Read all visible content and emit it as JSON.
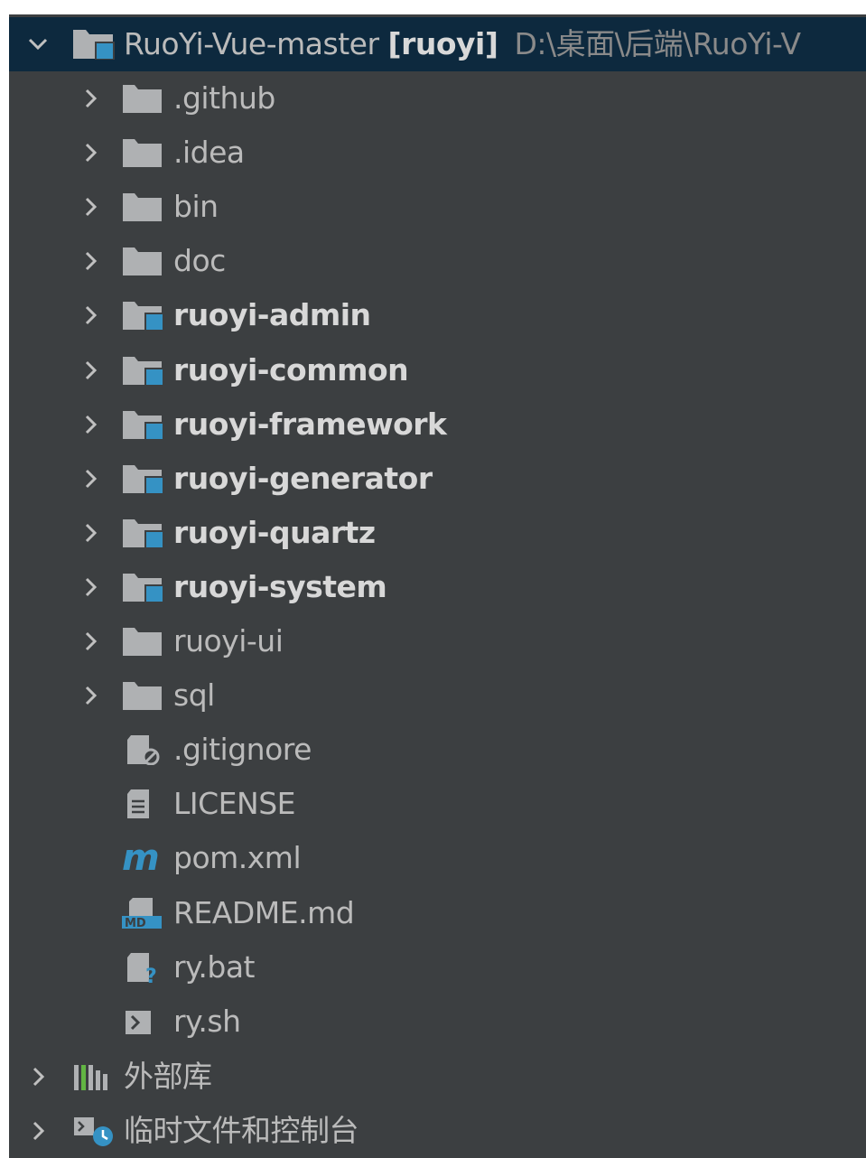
{
  "project": {
    "name": "RuoYi-Vue-master",
    "module": "[ruoyi]",
    "path": "D:\\桌面\\后端\\RuoYi-V"
  },
  "items": [
    {
      "label": ".github",
      "kind": "folder",
      "icon": "folder-icon"
    },
    {
      "label": ".idea",
      "kind": "folder",
      "icon": "folder-icon"
    },
    {
      "label": "bin",
      "kind": "folder",
      "icon": "folder-icon"
    },
    {
      "label": "doc",
      "kind": "folder",
      "icon": "folder-icon"
    },
    {
      "label": "ruoyi-admin",
      "kind": "module",
      "icon": "module-folder-icon"
    },
    {
      "label": "ruoyi-common",
      "kind": "module",
      "icon": "module-folder-icon"
    },
    {
      "label": "ruoyi-framework",
      "kind": "module",
      "icon": "module-folder-icon"
    },
    {
      "label": "ruoyi-generator",
      "kind": "module",
      "icon": "module-folder-icon"
    },
    {
      "label": "ruoyi-quartz",
      "kind": "module",
      "icon": "module-folder-icon"
    },
    {
      "label": "ruoyi-system",
      "kind": "module",
      "icon": "module-folder-icon"
    },
    {
      "label": "ruoyi-ui",
      "kind": "folder",
      "icon": "folder-icon"
    },
    {
      "label": "sql",
      "kind": "folder",
      "icon": "folder-icon"
    },
    {
      "label": ".gitignore",
      "kind": "file",
      "icon": "ignored-file-icon"
    },
    {
      "label": "LICENSE",
      "kind": "file",
      "icon": "text-file-icon"
    },
    {
      "label": "pom.xml",
      "kind": "file",
      "icon": "maven-icon"
    },
    {
      "label": "README.md",
      "kind": "file",
      "icon": "markdown-file-icon"
    },
    {
      "label": "ry.bat",
      "kind": "file",
      "icon": "unknown-file-icon"
    },
    {
      "label": "ry.sh",
      "kind": "file",
      "icon": "shell-script-icon"
    }
  ],
  "external_libraries": {
    "label": "外部库",
    "icon": "libraries-icon"
  },
  "scratches": {
    "label": "临时文件和控制台",
    "icon": "scratches-icon"
  },
  "colors": {
    "panel_bg": "#3c3f41",
    "selected_row_bg": "#0d293e",
    "text": "#bbbbbb",
    "folder_icon": "#afb1b3",
    "module_accent": "#3592c4"
  }
}
